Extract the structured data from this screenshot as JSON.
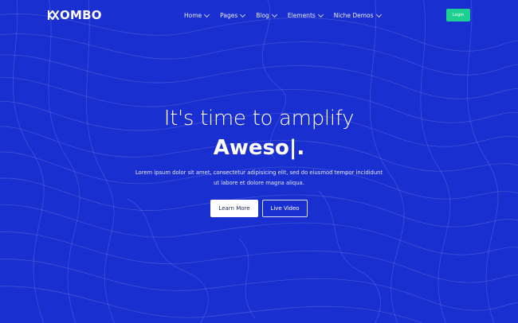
{
  "brand": {
    "name": "OMBO",
    "logo_icon": "k-logo-icon"
  },
  "nav": {
    "items": [
      {
        "label": "Home",
        "icon": "chevron-down-icon"
      },
      {
        "label": "Pages",
        "icon": "chevron-down-icon"
      },
      {
        "label": "Blog",
        "icon": "chevron-down-icon"
      },
      {
        "label": "Elements",
        "icon": "chevron-down-icon"
      },
      {
        "label": "Niche Demos",
        "icon": "chevron-down-icon"
      }
    ],
    "login_label": "Login"
  },
  "hero": {
    "headline": "It's time to amplify",
    "typed_word": "Aweso|.",
    "description": "Lorem ipsum dolor sit amet, consectetur adipisicing elit, sed do eiusmod tempor incididunt ut labore et dolore magna aliqua.",
    "primary_button": "Learn More",
    "secondary_button": "Live Video"
  },
  "colors": {
    "background": "#1a2fd0",
    "accent": "#1ed08f",
    "text": "#ffffff"
  }
}
